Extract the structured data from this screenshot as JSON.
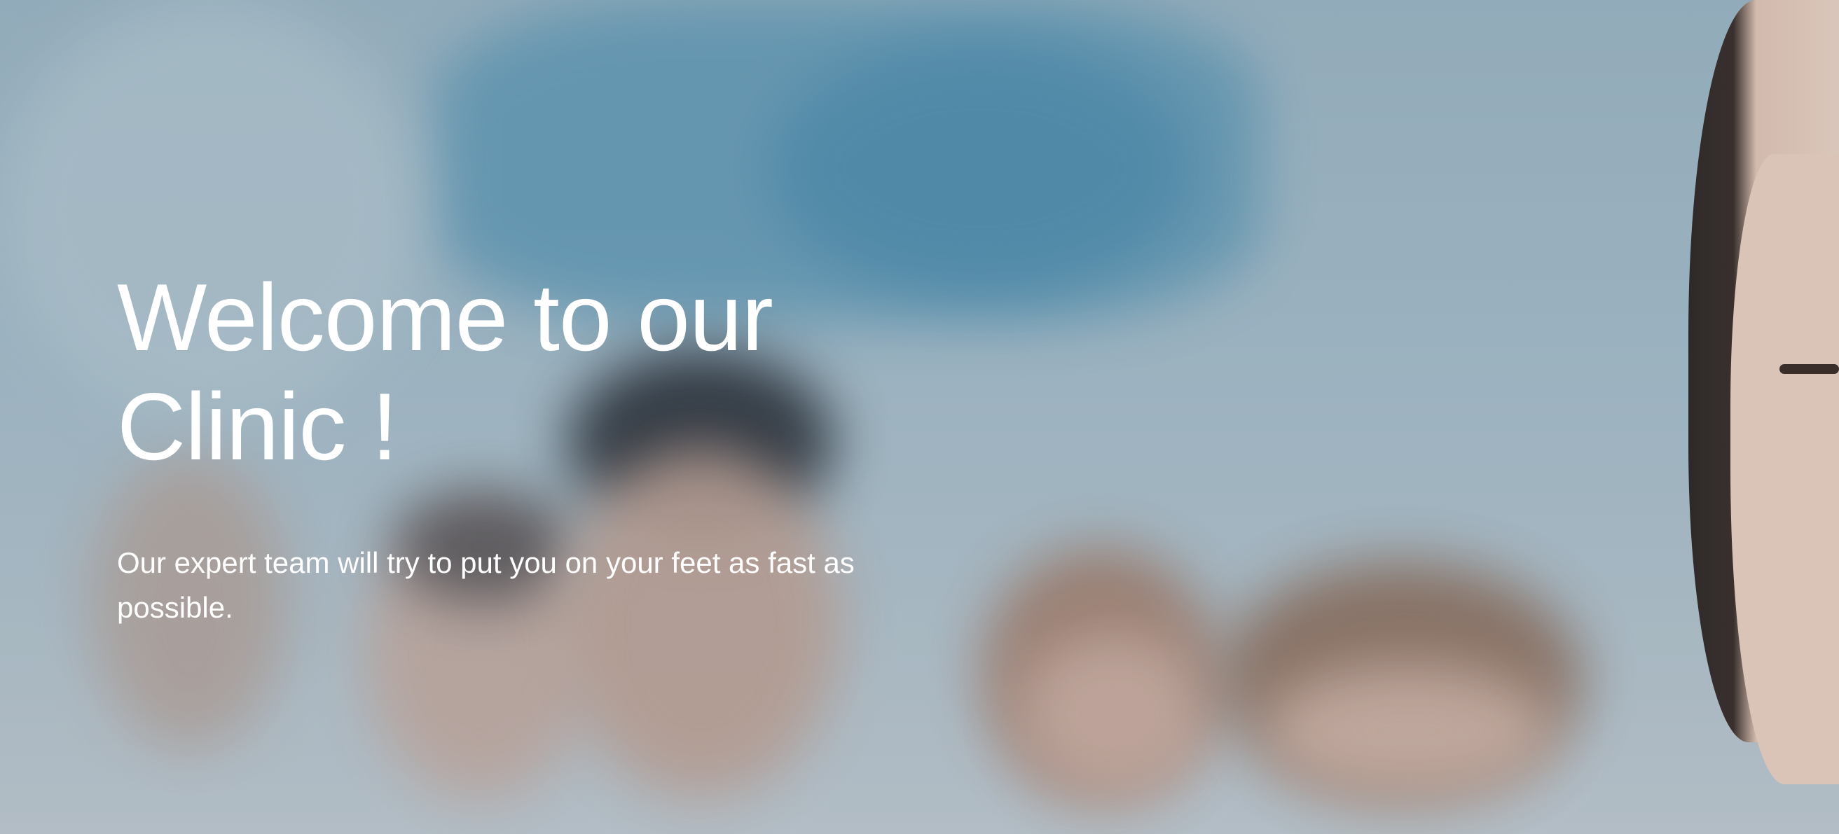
{
  "hero": {
    "title": "Welcome to our Clinic !",
    "subtitle": "Our expert team will try to put you on your feet as fast as possible."
  },
  "colors": {
    "text": "#ffffff",
    "background": "#a9bcc8"
  }
}
